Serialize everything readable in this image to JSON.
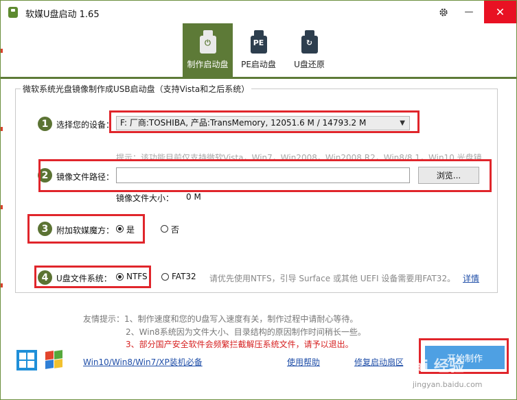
{
  "window": {
    "title": "软媒U盘启动 1.65",
    "settings_icon": "gear-icon",
    "minimize_glyph": "—",
    "close_glyph": "✕"
  },
  "tabs": [
    {
      "label": "制作启动盘",
      "icon": "usb-power-icon",
      "glyph": "⏻",
      "active": true
    },
    {
      "label": "PE启动盘",
      "icon": "usb-pe-icon",
      "glyph": "PE",
      "active": false
    },
    {
      "label": "U盘还原",
      "icon": "usb-restore-icon",
      "glyph": "↻",
      "active": false
    }
  ],
  "group_title": "微软系统光盘镜像制作成USB启动盘（支持Vista和之后系统）",
  "steps": {
    "s1": "1",
    "s2": "2",
    "s3": "3",
    "s4": "4"
  },
  "device": {
    "label": "选择您的设备：",
    "selected": "F: 厂商:TOSHIBA, 产品:TransMemory,  12051.6 M / 14793.2 M"
  },
  "image": {
    "hint": "提示：该功能目前仅支持微软Vista，Win7，Win2008，Win2008 R2，Win8/8.1，Win10 光盘镜像",
    "label": "镜像文件路径：",
    "value": "",
    "browse_label": "浏览...",
    "size_label": "镜像文件大小：",
    "size_value": "0 M"
  },
  "addon": {
    "label": "附加软媒魔方：",
    "yes": "是",
    "no": "否",
    "selected": "yes"
  },
  "fs": {
    "label": "U盘文件系统：",
    "ntfs": "NTFS",
    "fat32": "FAT32",
    "selected": "ntfs",
    "note": "请优先使用NTFS，引导 Surface 或其他 UEFI 设备需要用FAT32。",
    "details_link": "详情"
  },
  "tips": {
    "line1": "友情提示：1、制作速度和您的U盘写入速度有关，制作过程中请耐心等待。",
    "line2": "2、Win8系统因为文件大小、目录结构的原因制作时间稍长一些。",
    "line3": "3、部分国产安全软件会频繁拦截解压系统文件，请予以退出。"
  },
  "footer": {
    "link_install": "Win10/Win8/Win7/XP装机必备",
    "link_help": "使用帮助",
    "link_repair": "修复启动扇区",
    "start_label": "开始制作"
  },
  "watermark": {
    "text": "Bai 经验",
    "url": "jingyan.baidu.com"
  },
  "colors": {
    "accent_green": "#5d7a37",
    "highlight_red": "#e0252b",
    "start_blue": "#4ea0e3",
    "close_red": "#e81123"
  }
}
